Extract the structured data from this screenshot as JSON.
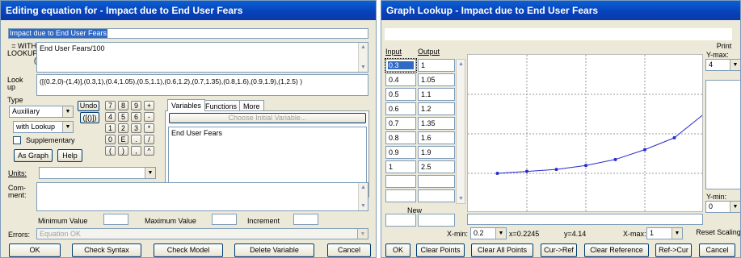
{
  "editor": {
    "title": "Editing equation for - Impact due to End User Fears",
    "var_name": "Impact due to End User Fears",
    "eq_label": "= WITH LOOKUP (",
    "eq_text": "End User Fears/100",
    "lookup_label": "Look up",
    "lookup_text": "([(0.2,0)-(1,4)],(0.3,1),(0.4,1.05),(0.5,1.1),(0.6,1.2),(0.7,1.35),(0.8,1.6),(0.9,1.9),(1,2.5) )",
    "type_label": "Type",
    "type_value": "Auxiliary",
    "subtype_value": "with Lookup",
    "supplementary_label": "Supplementary",
    "as_graph": "As Graph",
    "help": "Help",
    "undo": "Undo",
    "keypad": [
      [
        "7",
        "8",
        "9",
        "+"
      ],
      [
        "4",
        "5",
        "6",
        "-"
      ],
      [
        "1",
        "2",
        "3",
        "*"
      ],
      [
        "0",
        "E",
        ".",
        "/"
      ],
      [
        "(",
        ")",
        ",",
        "^"
      ]
    ],
    "brackets_btn": "([()])",
    "tabs": [
      "Variables",
      "Functions",
      "More"
    ],
    "choose_initial": "Choose Initial Variable...",
    "variables": [
      "End User Fears"
    ],
    "units_label": "Units:",
    "comment_label": "Com- ment:",
    "min_label": "Minimum Value",
    "max_label": "Maximum Value",
    "inc_label": "Increment",
    "errors_label": "Errors:",
    "errors_value": "Equation OK",
    "buttons": [
      "OK",
      "Check Syntax",
      "Check Model",
      "Delete Variable",
      "Cancel"
    ]
  },
  "lookup": {
    "title": "Graph Lookup - Impact due to End User Fears",
    "print": "Print",
    "input_hdr": "Input",
    "output_hdr": "Output",
    "inputs": [
      "0.3",
      "0.4",
      "0.5",
      "0.6",
      "0.7",
      "0.8",
      "0.9",
      "1"
    ],
    "outputs": [
      "1",
      "1.05",
      "1.1",
      "1.2",
      "1.35",
      "1.6",
      "1.9",
      "2.5"
    ],
    "new_label": "New",
    "ymax_label": "Y-max:",
    "ymax_value": "4",
    "ymin_label": "Y-min:",
    "ymin_value": "0",
    "xmin_label": "X-min:",
    "xmin_value": "0.2",
    "x_readout": "x=0.2245",
    "y_readout": "y=4.14",
    "xmax_label": "X-max:",
    "xmax_value": "1",
    "reset_scaling": "Reset Scaling",
    "buttons": [
      "OK",
      "Clear Points",
      "Clear All Points",
      "Cur->Ref",
      "Clear Reference",
      "Ref->Cur",
      "Cancel"
    ]
  },
  "chart_data": {
    "type": "line",
    "x": [
      0.3,
      0.4,
      0.5,
      0.6,
      0.7,
      0.8,
      0.9,
      1
    ],
    "series": [
      {
        "values": [
          1,
          1.05,
          1.1,
          1.2,
          1.35,
          1.6,
          1.9,
          2.5
        ]
      }
    ],
    "xlim": [
      0.2,
      1
    ],
    "ylim": [
      0,
      4
    ],
    "grid": true,
    "color": "#2a2ad0"
  }
}
